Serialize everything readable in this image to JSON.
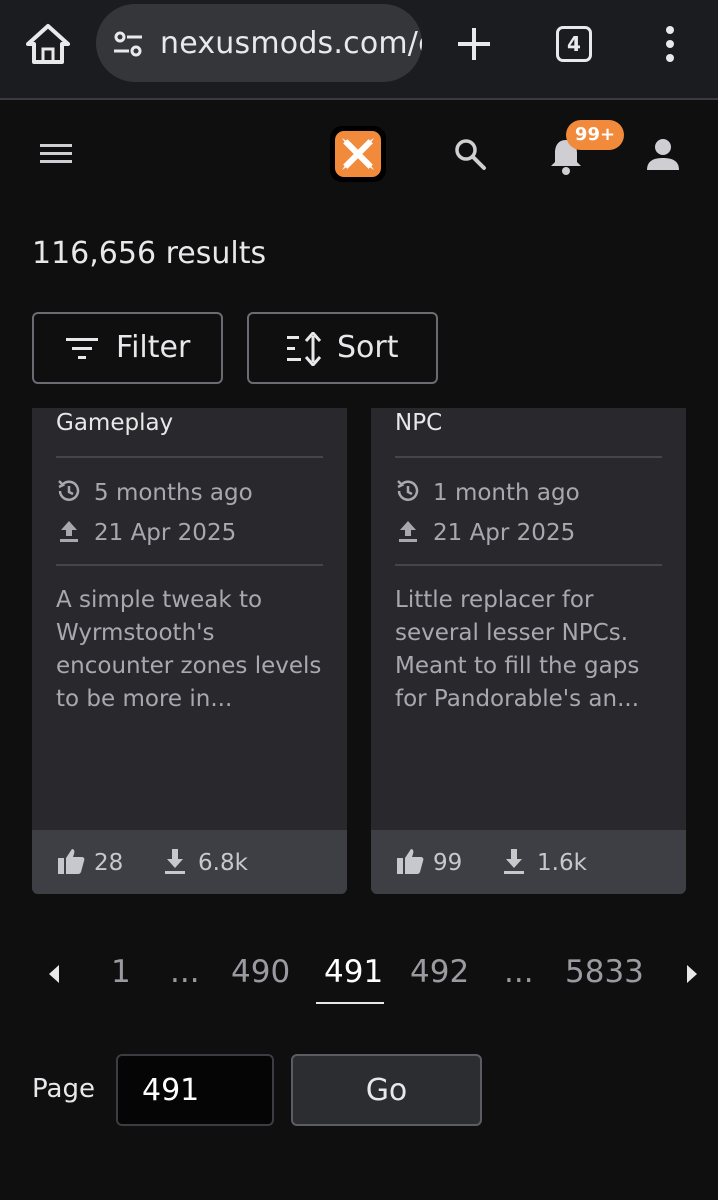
{
  "browser": {
    "url": "nexusmods.com/g",
    "tab_count": "4"
  },
  "header": {
    "notification_badge": "99+",
    "accent_color": "#f18a3b"
  },
  "results_text": "116,656 results",
  "toolbar": {
    "filter_label": "Filter",
    "sort_label": "Sort"
  },
  "cards": [
    {
      "category": "Gameplay",
      "updated": "5 months ago",
      "uploaded": "21 Apr 2025",
      "description": "A simple tweak to Wyrmstooth's encounter zones levels to be more in...",
      "endorsements": "28",
      "downloads": "6.8k"
    },
    {
      "category": "NPC",
      "updated": "1 month ago",
      "uploaded": "21 Apr 2025",
      "description": "Little replacer for several lesser NPCs. Meant to fill the gaps for Pandorable's an...",
      "endorsements": "99",
      "downloads": "1.6k"
    }
  ],
  "pagination": {
    "first": "1",
    "ellipsis": "...",
    "prev_page": "490",
    "current_page": "491",
    "next_page": "492",
    "last": "5833"
  },
  "goto": {
    "label": "Page",
    "value": "491",
    "button": "Go"
  }
}
